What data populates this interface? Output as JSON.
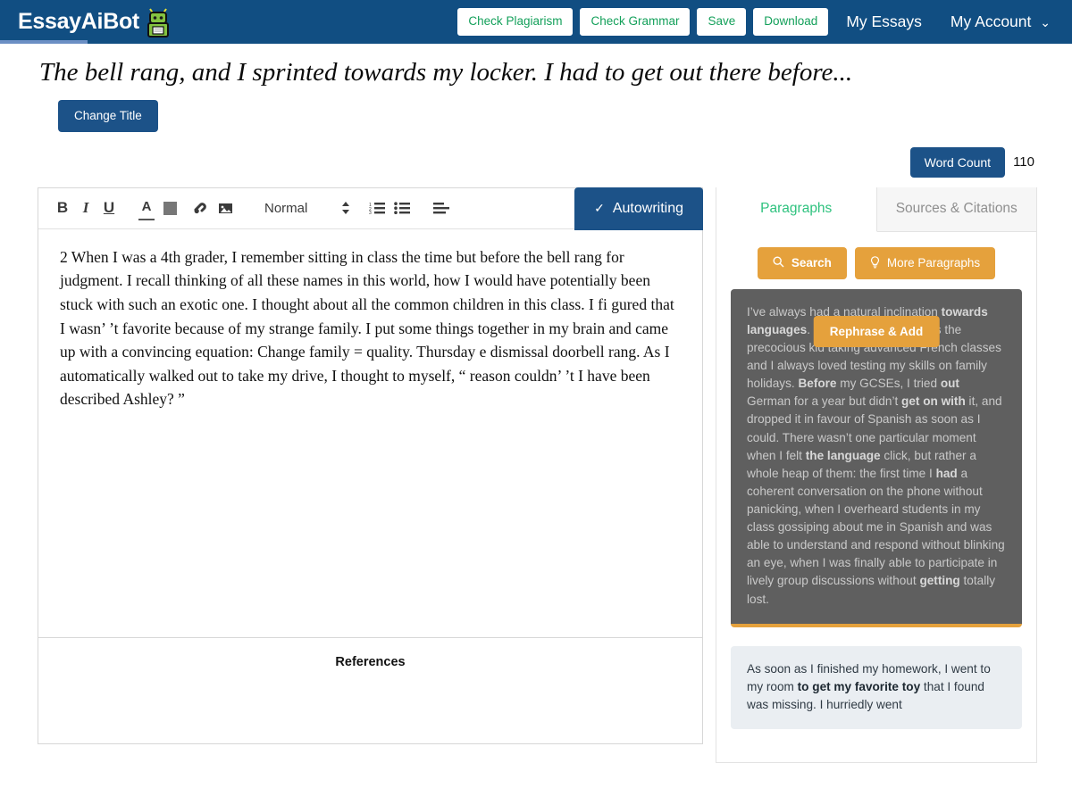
{
  "header": {
    "brand": "EssayAiBot",
    "logo_icon": "robot-icon",
    "buttons": [
      {
        "label": "Check Plagiarism",
        "name": "check-plagiarism-button"
      },
      {
        "label": "Check Grammar",
        "name": "check-grammar-button"
      },
      {
        "label": "Save",
        "name": "save-button"
      },
      {
        "label": "Download",
        "name": "download-button"
      }
    ],
    "links": [
      {
        "label": "My Essays",
        "name": "my-essays-link"
      },
      {
        "label": "My Account",
        "name": "my-account-menu",
        "caret": "⌄"
      }
    ],
    "accent_blue": "#114e82",
    "button_text_green": "#13a05a"
  },
  "title_area": {
    "essay_title": "The bell rang, and I sprinted towards my locker. I had to get out there before...",
    "change_title_label": "Change Title"
  },
  "word_count": {
    "label": "Word Count",
    "value": "110"
  },
  "toolbar": {
    "bold": "B",
    "italic": "I",
    "underline": "U",
    "text_color": "A",
    "highlight": "▒",
    "link": "🔗",
    "image": "🖼",
    "style_select": "Normal",
    "select_arrows": "↕",
    "ordered_list": "≡",
    "unordered_list": "≡",
    "align": "≡",
    "autowriting_label": "Autowriting",
    "autowriting_check": "✓"
  },
  "editor": {
    "content": "2 When I was a 4th grader, I remember sitting in class the time but before the bell rang for judgment. I recall thinking of all these names in this world, how I would have potentially been stuck with such an exotic one. I thought about all the common children in this class. I fi gured that I wasn’ ’t favorite because of my strange family. I put some things together in my brain and came up with a convincing equation: Change family = quality. Thursday e dismissal doorbell rang. As I automatically walked out to take my drive, I thought to myself, “ reason couldn’ ’t I have been described Ashley? ”",
    "references_heading": "References"
  },
  "panel": {
    "tabs": [
      {
        "label": "Paragraphs",
        "name": "tab-paragraphs",
        "active": true
      },
      {
        "label": "Sources & Citations",
        "name": "tab-sources-citations",
        "active": false
      }
    ],
    "actions": [
      {
        "label": "Search",
        "icon": "search-icon",
        "glyph": "⚲"
      },
      {
        "label": "More Paragraphs",
        "icon": "lightbulb-icon",
        "glyph": "💡"
      }
    ],
    "rephrase_label": "Rephrase & Add",
    "card_accent_orange": "#e5a13c",
    "cards": [
      {
        "name": "paragraph-card-dark",
        "segments": [
          {
            "text": "I’ve always had a natural inclination ",
            "bold": false
          },
          {
            "text": "towards languages",
            "bold": true
          },
          {
            "text": ". In primary school, I was the precocious kid taking advanced French classes and I always loved testing my skills on family holidays. ",
            "bold": false
          },
          {
            "text": "Before",
            "bold": true
          },
          {
            "text": " my GCSEs, I tried ",
            "bold": false
          },
          {
            "text": "out",
            "bold": true
          },
          {
            "text": " German for a year but didn’t ",
            "bold": false
          },
          {
            "text": "get on with",
            "bold": true
          },
          {
            "text": " it, and dropped it in favour of Spanish as soon as I could. There wasn’t one particular moment when I felt ",
            "bold": false
          },
          {
            "text": "the language",
            "bold": true
          },
          {
            "text": " click, but rather a whole heap of them: the first time I ",
            "bold": false
          },
          {
            "text": "had",
            "bold": true
          },
          {
            "text": " a coherent conversation on the phone without panicking, when I overheard students in my class gossiping about me in Spanish and was able to understand and respond without blinking an eye, when I was finally able to participate in lively group discussions without ",
            "bold": false
          },
          {
            "text": "getting",
            "bold": true
          },
          {
            "text": " totally lost.",
            "bold": false
          }
        ]
      },
      {
        "name": "paragraph-card-light",
        "segments": [
          {
            "text": "As soon as I finished my homework, I went to my room ",
            "bold": false
          },
          {
            "text": "to get my favorite toy",
            "bold": true
          },
          {
            "text": " that I found was missing. I hurriedly went",
            "bold": false
          }
        ]
      }
    ]
  }
}
